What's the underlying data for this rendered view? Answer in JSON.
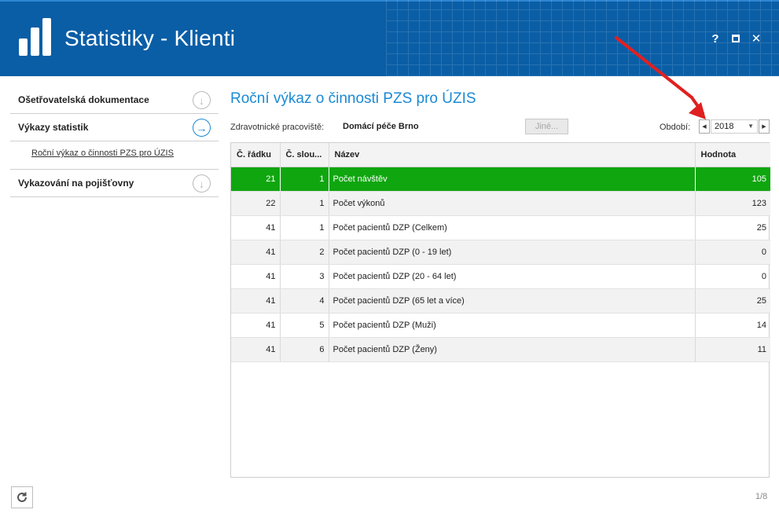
{
  "window": {
    "title": "Statistiky - Klienti",
    "help_label": "?",
    "close_label": "✕"
  },
  "sidebar": {
    "items": [
      {
        "label": "Ošetřovatelská dokumentace",
        "icon": "arrow-down-circle-icon"
      },
      {
        "label": "Výkazy statistik",
        "icon": "arrow-right-circle-icon",
        "active": true
      },
      {
        "label": "Vykazování na pojišťovny",
        "icon": "arrow-down-circle-icon"
      }
    ],
    "sub_items": [
      {
        "label": "Roční výkaz o činnosti PZS pro ÚZIS"
      }
    ]
  },
  "main": {
    "title": "Roční výkaz o činnosti PZS pro ÚZIS",
    "workplace_label": "Zdravotnické pracoviště:",
    "workplace_value": "Domácí péče Brno",
    "other_button": "Jiné...",
    "period_label": "Období:",
    "period_value": "2018"
  },
  "table": {
    "columns": [
      "Č. řádku",
      "Č. slou...",
      "Název",
      "Hodnota"
    ],
    "rows": [
      {
        "row": "21",
        "col": "1",
        "name": "Počet návštěv",
        "value": "105"
      },
      {
        "row": "22",
        "col": "1",
        "name": "Počet výkonů",
        "value": "123"
      },
      {
        "row": "41",
        "col": "1",
        "name": "Počet pacientů DZP (Celkem)",
        "value": "25"
      },
      {
        "row": "41",
        "col": "2",
        "name": "Počet pacientů DZP (0 - 19 let)",
        "value": "0"
      },
      {
        "row": "41",
        "col": "3",
        "name": "Počet pacientů DZP (20 - 64 let)",
        "value": "0"
      },
      {
        "row": "41",
        "col": "4",
        "name": "Počet pacientů DZP (65 let a více)",
        "value": "25"
      },
      {
        "row": "41",
        "col": "5",
        "name": "Počet pacientů DZP (Muži)",
        "value": "14"
      },
      {
        "row": "41",
        "col": "6",
        "name": "Počet pacientů DZP (Ženy)",
        "value": "11"
      }
    ],
    "selected_row_index": 0
  },
  "footer": {
    "page_counter": "1/8"
  },
  "colors": {
    "header_bg": "#0a5ea6",
    "accent": "#1a8ad4",
    "selected_row": "#0fa60f",
    "annotation_arrow": "#e02020"
  }
}
